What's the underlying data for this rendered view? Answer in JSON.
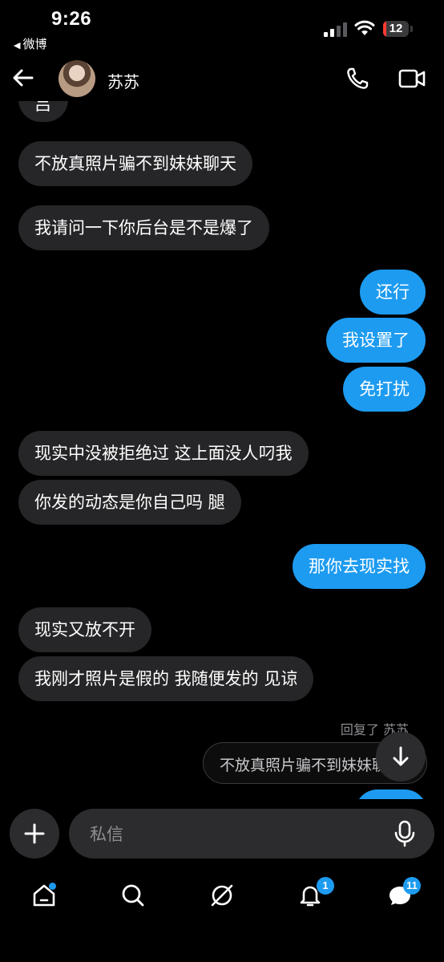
{
  "status_bar": {
    "time": "9:26",
    "back_app": "微博",
    "battery_level": "12",
    "battery_fraction": 0.12
  },
  "header": {
    "contact_name": "苏苏"
  },
  "messages": [
    {
      "side": "in",
      "text": "不放真照片骗不到妹妹聊天"
    },
    {
      "side": "in",
      "text": "我请问一下你后台是不是爆了"
    },
    {
      "side": "out",
      "text": "还行"
    },
    {
      "side": "out",
      "text": "我设置了"
    },
    {
      "side": "out",
      "text": "免打扰"
    },
    {
      "side": "in",
      "text": "现实中没被拒绝过 这上面没人叼我"
    },
    {
      "side": "in",
      "text": "你发的动态是你自己吗 腿"
    },
    {
      "side": "out",
      "text": "那你去现实找"
    },
    {
      "side": "in",
      "text": "现实又放不开"
    },
    {
      "side": "in",
      "text": "我刚才照片是假的 我随便发的 见谅"
    }
  ],
  "partial_top_text": "吕",
  "reply": {
    "meta": "回复了 苏苏",
    "quoted_text": "不放真照片骗不到妹妹聊天"
  },
  "composer": {
    "placeholder": "私信"
  },
  "tabs": {
    "notifications_badge": "1",
    "messages_badge": "11"
  },
  "colors": {
    "background": "#000000",
    "incoming_bubble": "#262628",
    "outgoing_bubble": "#1d9bf0",
    "accent": "#1d9bf0"
  }
}
